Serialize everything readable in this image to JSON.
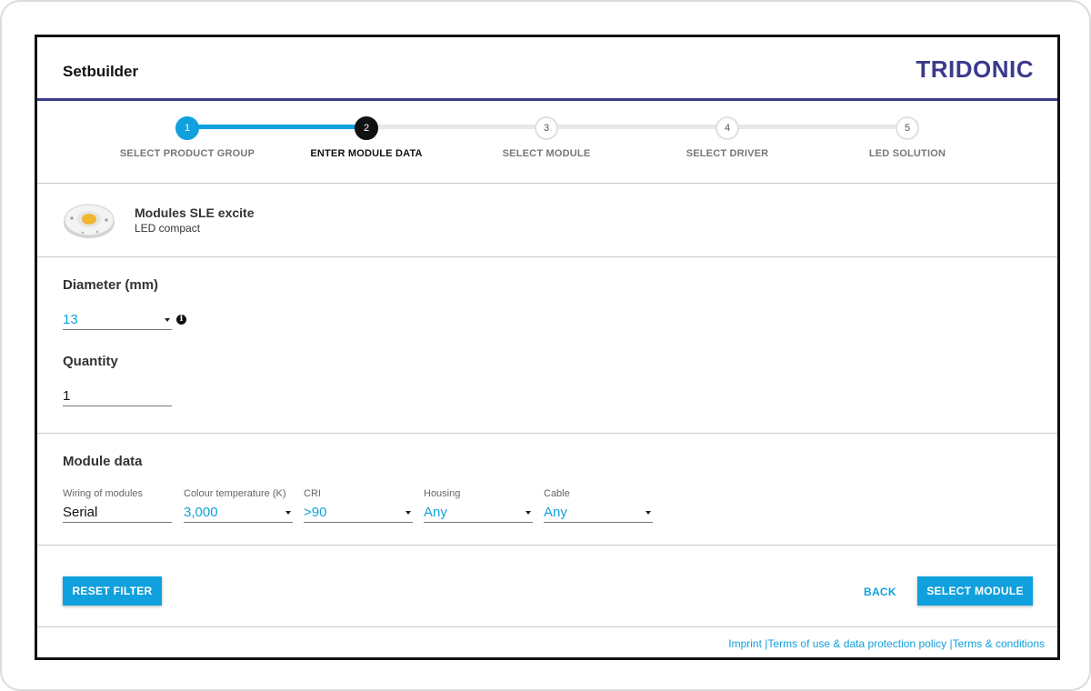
{
  "header": {
    "title": "Setbuilder",
    "logo": "TRIDONIC"
  },
  "stepper": {
    "steps": [
      {
        "num": "1",
        "label": "SELECT PRODUCT GROUP",
        "state": "done"
      },
      {
        "num": "2",
        "label": "ENTER MODULE DATA",
        "state": "current"
      },
      {
        "num": "3",
        "label": "SELECT MODULE",
        "state": "pending"
      },
      {
        "num": "4",
        "label": "SELECT DRIVER",
        "state": "pending"
      },
      {
        "num": "5",
        "label": "LED SOLUTION",
        "state": "pending"
      }
    ]
  },
  "product": {
    "name": "Modules SLE excite",
    "type": "LED compact"
  },
  "params": {
    "diameter_label": "Diameter (mm)",
    "diameter_value": "13",
    "quantity_label": "Quantity",
    "quantity_value": "1"
  },
  "module_data": {
    "title": "Module data",
    "fields": [
      {
        "label": "Wiring of modules",
        "value": "Serial"
      },
      {
        "label": "Colour temperature (K)",
        "value": "3,000"
      },
      {
        "label": "CRI",
        "value": ">90"
      },
      {
        "label": "Housing",
        "value": "Any"
      },
      {
        "label": "Cable",
        "value": "Any"
      }
    ]
  },
  "actions": {
    "reset": "RESET FILTER",
    "back": "BACK",
    "select": "SELECT MODULE"
  },
  "footer": {
    "imprint": "Imprint",
    "sep": " |",
    "terms_use": "Terms of use & data protection policy",
    "terms_cond": "Terms & conditions"
  },
  "colors": {
    "accent": "#10a0dd",
    "brand": "#3c3a8c"
  }
}
